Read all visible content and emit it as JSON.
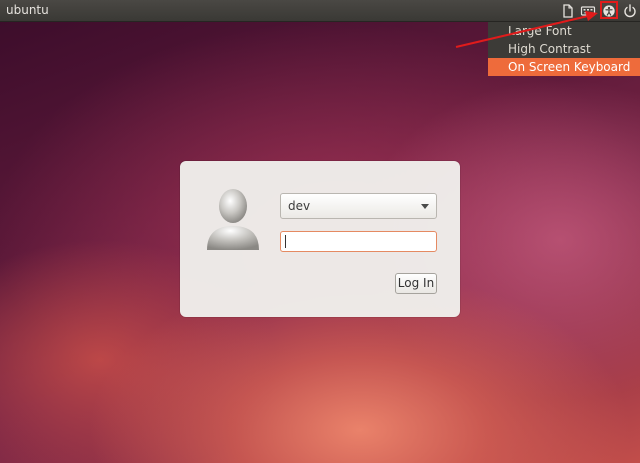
{
  "panel": {
    "hostname": "ubuntu",
    "indicators": [
      {
        "icon": "file-icon"
      },
      {
        "icon": "keyboard-layout-icon"
      },
      {
        "icon": "accessibility-icon"
      },
      {
        "icon": "power-icon"
      }
    ]
  },
  "accessibility_menu": {
    "items": [
      {
        "label": "Large Font"
      },
      {
        "label": "High Contrast"
      },
      {
        "label": "On Screen Keyboard",
        "highlighted": true
      }
    ]
  },
  "login": {
    "username": "dev",
    "password_value": "",
    "login_button": "Log In"
  },
  "colors": {
    "panel": "#3c3b37",
    "menu_highlight": "#ee6b3b",
    "annotation": "#e01b1b"
  }
}
